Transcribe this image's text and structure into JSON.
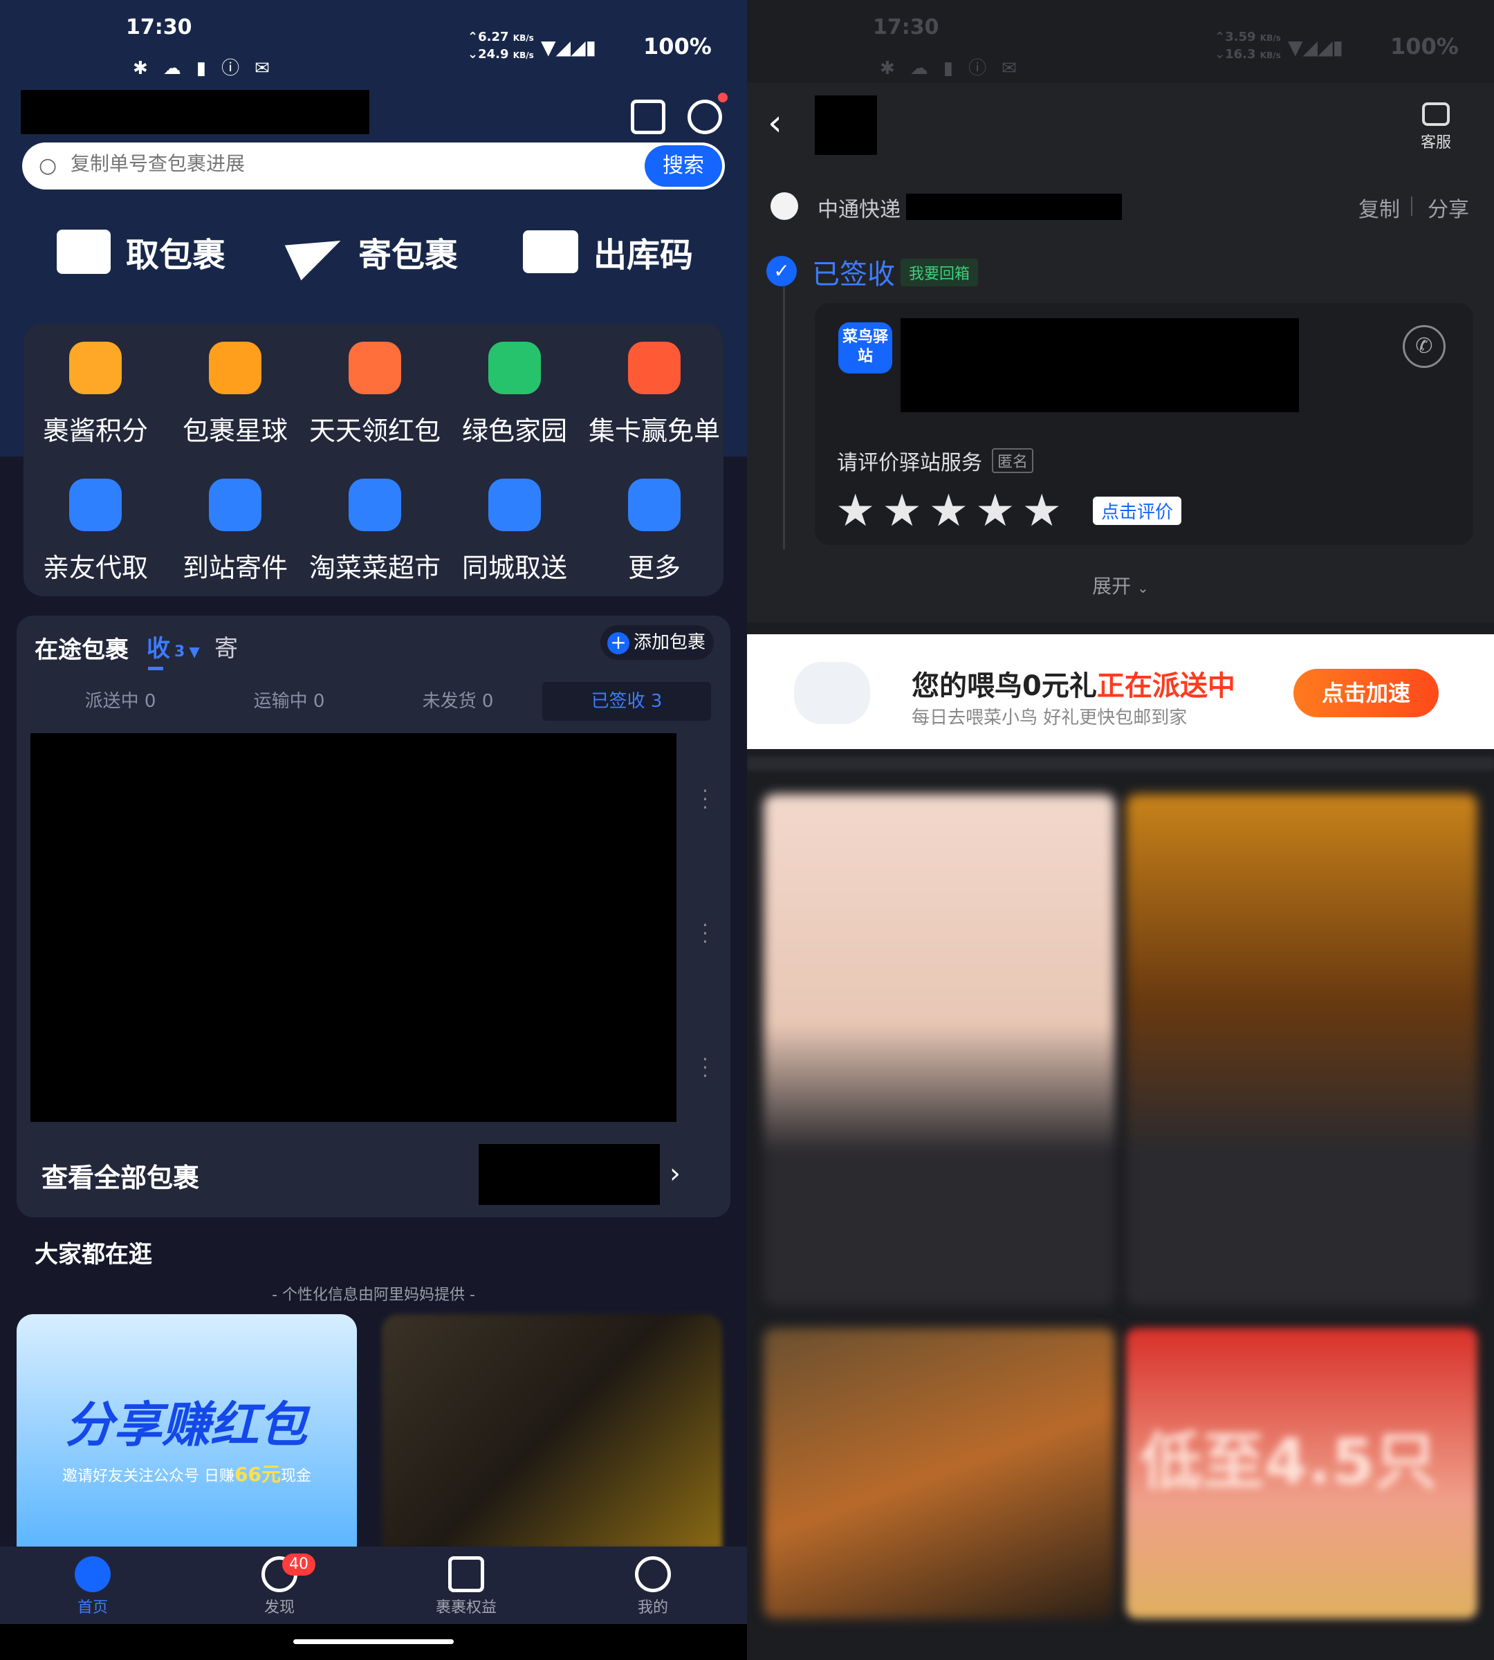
{
  "left": {
    "status": {
      "time": "17:30",
      "net_up": "6.27",
      "net_down": "24.9",
      "net_unit": "KB/s",
      "battery": "100%"
    },
    "search": {
      "placeholder": "复制单号查包裹进展",
      "button": "搜索"
    },
    "quick_actions": [
      {
        "label": "取包裹",
        "icon": "package-box-icon"
      },
      {
        "label": "寄包裹",
        "icon": "paper-plane-icon"
      },
      {
        "label": "出库码",
        "icon": "id-card-icon"
      }
    ],
    "services": [
      {
        "label": "裹酱积分",
        "icon": "mascot-points-icon",
        "color": "#ffa726"
      },
      {
        "label": "包裹星球",
        "icon": "planet-icon",
        "color": "#ff9f1c"
      },
      {
        "label": "天天领红包",
        "icon": "red-envelope-icon",
        "color": "#ff6f3c"
      },
      {
        "label": "绿色家园",
        "icon": "green-house-icon",
        "color": "#27c26c"
      },
      {
        "label": "集卡赢免单",
        "icon": "card-collect-icon",
        "color": "#ff5a36"
      },
      {
        "label": "亲友代取",
        "icon": "friend-pickup-icon",
        "color": "#2f80ff"
      },
      {
        "label": "到站寄件",
        "icon": "station-send-icon",
        "color": "#2f80ff"
      },
      {
        "label": "淘菜菜超市",
        "icon": "shopping-bag-icon",
        "color": "#2f80ff"
      },
      {
        "label": "同城取送",
        "icon": "location-pin-icon",
        "color": "#2f80ff"
      },
      {
        "label": "更多",
        "icon": "more-grid-icon",
        "color": "#2f80ff"
      }
    ],
    "packages": {
      "title": "在途包裹",
      "tab_receive": "收",
      "receive_count": "3",
      "tab_send": "寄",
      "add_button": "添加包裹",
      "status_tabs": [
        "派送中 0",
        "运输中 0",
        "未发货 0",
        "已签收 3"
      ],
      "view_all": "查看全部包裹"
    },
    "browse": {
      "title": "大家都在逛",
      "subtitle": "- 个性化信息由阿里妈妈提供 -",
      "banner_title": "分享赚红包",
      "banner_sub_pre": "邀请好友关注公众号 日赚",
      "banner_amount": "66元",
      "banner_sub_post": "现金"
    },
    "bottom_nav": [
      {
        "label": "首页",
        "icon": "home-mascot-icon",
        "active": true
      },
      {
        "label": "发现",
        "icon": "discover-icon",
        "badge": "40"
      },
      {
        "label": "裹裹权益",
        "icon": "crown-icon"
      },
      {
        "label": "我的",
        "icon": "profile-icon"
      }
    ]
  },
  "right": {
    "status": {
      "time": "17:30",
      "net_up": "3.59",
      "net_down": "16.3",
      "net_unit": "KB/s",
      "battery": "100%"
    },
    "header": {
      "service": "客服"
    },
    "carrier": {
      "name": "中通快递",
      "copy": "复制",
      "share": "分享"
    },
    "state": {
      "label": "已签收",
      "tag": "我要回箱"
    },
    "station": {
      "logo_text": "菜鸟驿站",
      "rate_prompt": "请评价驿站服务",
      "anonymous": "匿名",
      "rate_button": "点击评价",
      "stars": 5,
      "expand": "展开"
    },
    "promo": {
      "title_pre": "您的喂鸟0元礼",
      "title_hot": "正在派送中",
      "subtitle": "每日去喂菜小鸟 好礼更快包邮到家",
      "button": "点击加速"
    },
    "feed_banner_text": "低至4.5只",
    "colors": {
      "accent": "#1565ff",
      "promo_orange": "#ff5a1f",
      "promo_red": "#ff3b1f"
    }
  }
}
